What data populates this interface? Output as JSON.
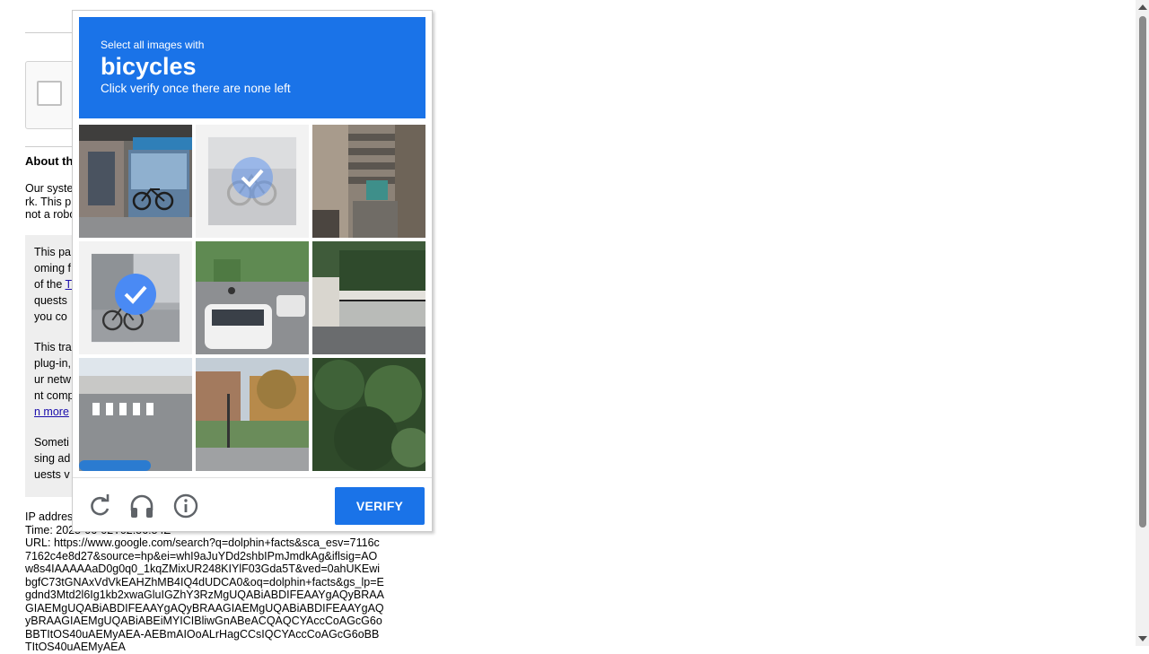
{
  "background_page": {
    "about_heading": "About th",
    "para1": "Our syste\nrk. This p\nnot a robo",
    "infobox": {
      "p1": "This pa\noming f\nof the ",
      "p1_link": "T",
      "p1_rest": "\nquests\nyou co",
      "p2": "This tra\nplug-in,\nur netw\nnt comp\n",
      "p2_link": "n more",
      "p3": "Someti\nsing ad\nuests v"
    },
    "meta_lines": "IP addres\nTime: 2025-06-02T02:56:54Z\nURL: https://www.google.com/search?q=dolphin+facts&sca_esv=7116c7162c4e8d27&source=hp&ei=whI9aJuYDd2shbIPmJmdkAg&iflsig=AOw8s4IAAAAAaD0g0q0_1kqZMixUR248KIYlF03Gda5T&ved=0ahUKEwibgfC73tGNAxVdVkEAHZhMB4IQ4dUDCA0&oq=dolphin+facts&gs_lp=Egdnd3Mtd2l6Ig1kb2xwaGluIGZhY3RzMgUQABiABDIFEAAYgAQyBRAAGIAEMgUQABiABDIFEAAYgAQyBRAAGIAEMgUQABiABDIFEAAYgAQyBRAAGIAEMgUQABiABEiMYICIBliwGnABeACQAQCYAccCoAGcG6oBBTItOS40uAEMyAEA-AEBmAIOoALrHagCCsIQCYAccCoAGcG6oBBTItOS40uAEMyAEA"
  },
  "captcha": {
    "instruction_line1": "Select all images with",
    "keyword": "bicycles",
    "instruction_line2": "Click verify once there are none left",
    "tiles": [
      {
        "label": "storefront-with-bicycles",
        "selected": false
      },
      {
        "label": "bicycles-parked",
        "selected": true,
        "faded": true
      },
      {
        "label": "stairs-alley",
        "selected": false
      },
      {
        "label": "bicycles-by-wall",
        "selected": true
      },
      {
        "label": "street-with-cars",
        "selected": false
      },
      {
        "label": "fence-hedge",
        "selected": false
      },
      {
        "label": "crosswalk",
        "selected": false
      },
      {
        "label": "street-trees",
        "selected": false
      },
      {
        "label": "forest",
        "selected": false
      }
    ],
    "verify_label": "VERIFY",
    "accent_color": "#1a73e8",
    "icons": [
      "reload-icon",
      "audio-headphones-icon",
      "info-icon"
    ]
  }
}
